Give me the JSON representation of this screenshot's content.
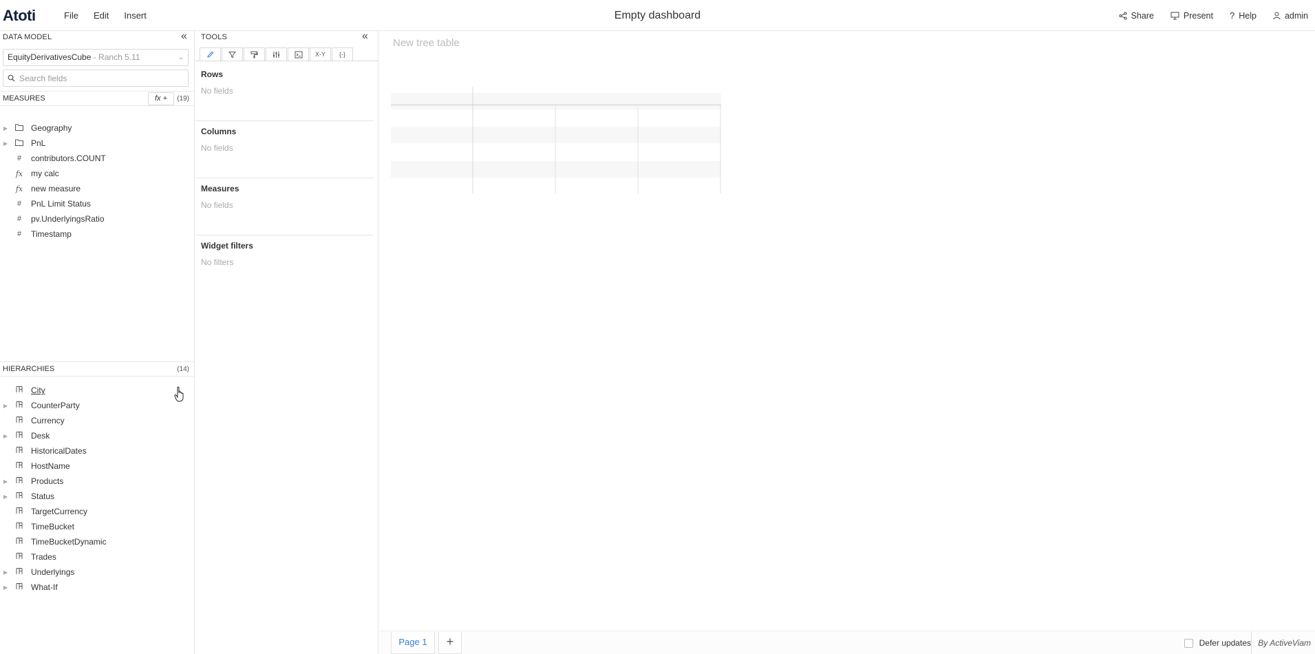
{
  "header": {
    "logo": "Atoti",
    "menu": [
      "File",
      "Edit",
      "Insert"
    ],
    "title": "Empty dashboard",
    "share": "Share",
    "present": "Present",
    "help": "Help",
    "user": "admin"
  },
  "data_model": {
    "title": "DATA MODEL",
    "cube": "EquityDerivativesCube",
    "cube_sub": " - Ranch 5.11",
    "search_placeholder": "Search fields",
    "measures_label": "MEASURES",
    "fx_label": "fx +",
    "measures_count": "(19)",
    "measures": [
      {
        "icon": "folder-icon",
        "label": "Geography",
        "expandable": true
      },
      {
        "icon": "folder-icon",
        "label": "PnL",
        "expandable": true
      },
      {
        "icon": "hash-icon",
        "label": "contributors.COUNT",
        "expandable": false
      },
      {
        "icon": "fx-icon",
        "label": "my calc",
        "expandable": false
      },
      {
        "icon": "fx-icon",
        "label": "new measure",
        "expandable": false
      },
      {
        "icon": "hash-icon",
        "label": "PnL Limit Status",
        "expandable": false
      },
      {
        "icon": "hash-icon",
        "label": "pv.UnderlyingsRatio",
        "expandable": false
      },
      {
        "icon": "hash-icon",
        "label": "Timestamp",
        "expandable": false
      }
    ],
    "hierarchies_label": "HIERARCHIES",
    "hierarchies_count": "(14)",
    "hierarchies": [
      {
        "label": "City",
        "expandable": false
      },
      {
        "label": "CounterParty",
        "expandable": true
      },
      {
        "label": "Currency",
        "expandable": false
      },
      {
        "label": "Desk",
        "expandable": true
      },
      {
        "label": "HistoricalDates",
        "expandable": false
      },
      {
        "label": "HostName",
        "expandable": false
      },
      {
        "label": "Products",
        "expandable": true
      },
      {
        "label": "Status",
        "expandable": true
      },
      {
        "label": "TargetCurrency",
        "expandable": false
      },
      {
        "label": "TimeBucket",
        "expandable": false
      },
      {
        "label": "TimeBucketDynamic",
        "expandable": false
      },
      {
        "label": "Trades",
        "expandable": false
      },
      {
        "label": "Underlyings",
        "expandable": true
      },
      {
        "label": "What-If",
        "expandable": true
      }
    ]
  },
  "tools": {
    "title": "TOOLS",
    "tabs": [
      "pencil-icon",
      "filter-icon",
      "paint-roller-icon",
      "sliders-icon",
      "terminal-icon",
      "xy-icon",
      "braces-icon"
    ],
    "xy_label": "X-Y",
    "braces_label": "{-}",
    "sections": [
      {
        "title": "Rows",
        "empty": "No fields"
      },
      {
        "title": "Columns",
        "empty": "No fields"
      },
      {
        "title": "Measures",
        "empty": "No fields"
      },
      {
        "title": "Widget filters",
        "empty": "No filters"
      }
    ]
  },
  "main": {
    "widget_title": "New tree table"
  },
  "footer": {
    "page_tab": "Page 1",
    "add_page": "+",
    "defer_updates": "Defer updates",
    "by": "By ActiveViam"
  },
  "colors": {
    "accent": "#3a7bd5",
    "logo": "#14213d"
  }
}
